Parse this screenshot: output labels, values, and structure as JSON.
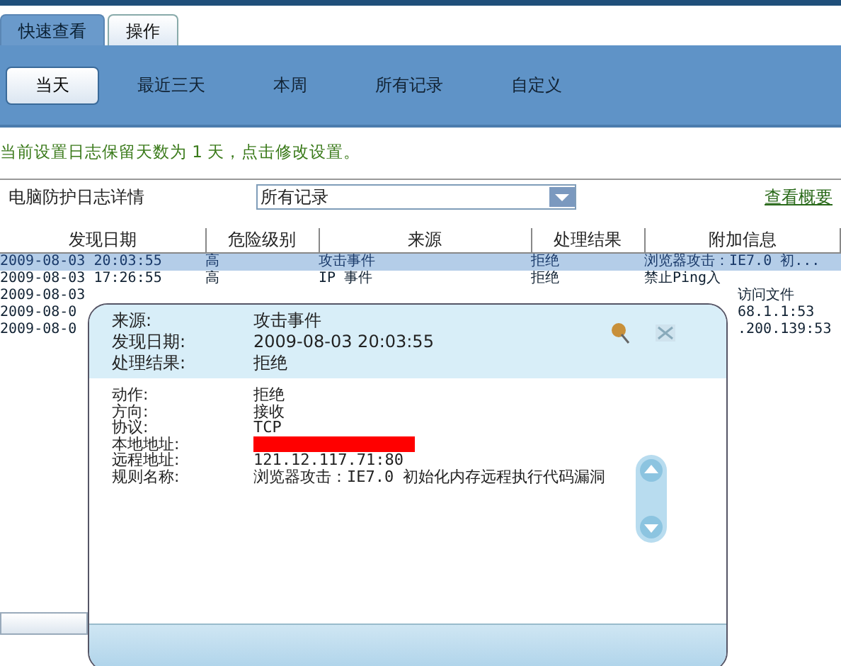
{
  "tabs": [
    {
      "label": "快速查看",
      "selected": true
    },
    {
      "label": "操作",
      "selected": false
    }
  ],
  "filters": [
    {
      "label": "当天",
      "selected": true
    },
    {
      "label": "最近三天",
      "selected": false
    },
    {
      "label": "本周",
      "selected": false
    },
    {
      "label": "所有记录",
      "selected": false
    },
    {
      "label": "自定义",
      "selected": false
    }
  ],
  "notice": "当前设置日志保留天数为 1 天，点击修改设置。",
  "log_section": {
    "title": "电脑防护日志详情",
    "filter_value": "所有记录",
    "summary_link": "查看概要"
  },
  "table": {
    "columns": [
      "发现日期",
      "危险级别",
      "来源",
      "处理结果",
      "附加信息"
    ],
    "rows": [
      {
        "selected": true,
        "cells": [
          "2009-08-03 20:03:55",
          "高",
          "攻击事件",
          "拒绝",
          "浏览器攻击：IE7.0 初..."
        ]
      },
      {
        "selected": false,
        "cells": [
          "2009-08-03 17:26:55",
          "高",
          "IP 事件",
          "拒绝",
          "禁止Ping入"
        ]
      },
      {
        "selected": false,
        "cells": [
          "2009-08-03",
          "",
          "",
          "",
          "访问文件"
        ]
      },
      {
        "selected": false,
        "cells": [
          "2009-08-0",
          "",
          "",
          "",
          "68.1.1:53"
        ]
      },
      {
        "selected": false,
        "cells": [
          "2009-08-0",
          "",
          "",
          "",
          ".200.139:53"
        ]
      }
    ]
  },
  "popup": {
    "summary": [
      {
        "label": "来源:",
        "value": "攻击事件"
      },
      {
        "label": "发现日期:",
        "value": "2009-08-03 20:03:55"
      },
      {
        "label": "处理结果:",
        "value": "拒绝"
      }
    ],
    "details": [
      {
        "kind": "text",
        "label": "动作:",
        "value": "拒绝"
      },
      {
        "kind": "text",
        "label": "方向:",
        "value": "接收"
      },
      {
        "kind": "text",
        "label": "协议:",
        "value": "TCP"
      },
      {
        "kind": "redacted",
        "label": "本地地址:"
      },
      {
        "kind": "text",
        "label": "远程地址:",
        "value": "121.12.117.71:80"
      },
      {
        "kind": "text",
        "label": "规则名称:",
        "value": "浏览器攻击：IE7.0 初始化内存远程执行代码漏洞"
      }
    ]
  }
}
